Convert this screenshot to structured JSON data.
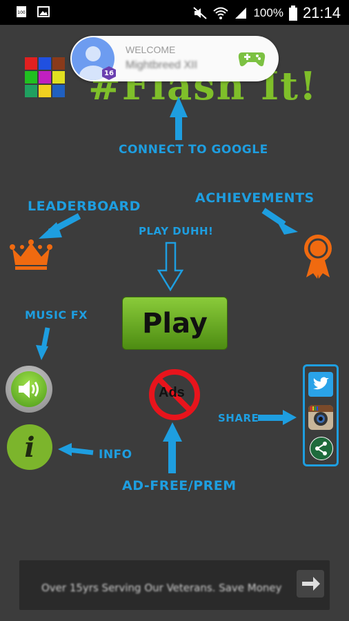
{
  "status_bar": {
    "battery_percent": "100%",
    "time": "21:14",
    "icons": [
      "notification-icon",
      "image-icon",
      "mute-icon",
      "wifi-icon",
      "signal-icon",
      "battery-icon"
    ]
  },
  "welcome_bar": {
    "label": "WELCOME",
    "player_name": "Mightbreed XII",
    "level_badge": "16",
    "icons": [
      "avatar-icon",
      "gamepad-icon"
    ]
  },
  "title": "#Flash It!",
  "labels": {
    "connect_google": "CONNECT TO GOOGLE",
    "leaderboard": "LEADERBOARD",
    "achievements": "ACHIEVEMENTS",
    "play_duhh": "PLAY DUHH!",
    "music_fx": "MUSIC FX",
    "share": "SHARE",
    "info": "INFO",
    "ad_free": "AD-FREE/PREM"
  },
  "play_button": {
    "label": "Play"
  },
  "info_button": {
    "label": "i"
  },
  "no_ads_button": {
    "label": "Ads"
  },
  "share_icons": [
    "twitter-icon",
    "instagram-icon",
    "share-icon"
  ],
  "ad_banner": {
    "text": "Over 15yrs Serving Our Veterans. Save Money"
  },
  "colors": {
    "background": "#3c3c3c",
    "label_blue": "#1e9ee0",
    "play_green": "#6aab24",
    "orange": "#f06a10",
    "title_green": "#7fbf2a"
  },
  "logo_tiles": [
    "#e02020",
    "#2050e0",
    "#8a3a1a",
    "#20c020",
    "#c020c0",
    "#e0e020",
    "#20a060",
    "#f0d020",
    "#2060c0"
  ]
}
